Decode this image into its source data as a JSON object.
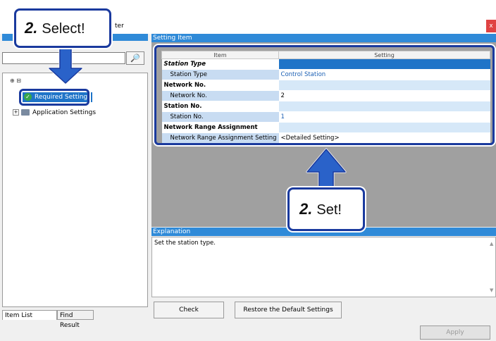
{
  "window": {
    "title_fragment": "ter",
    "close_label": "x"
  },
  "left_panel": {
    "search_value": "",
    "search_button_icon": "binoculars-icon",
    "tree_tools": "⊕ ⊟",
    "tree": [
      {
        "label": "Required Settings",
        "icon": "check-icon",
        "selected": true
      },
      {
        "label": "Application Settings",
        "icon": "folder-icon",
        "expander": "⊞"
      }
    ],
    "tabs": [
      "Item List",
      "Find Result"
    ]
  },
  "setting_item": {
    "header": "Setting Item",
    "columns": [
      "Item",
      "Setting"
    ],
    "rows": [
      {
        "type": "category",
        "item": "Station Type",
        "setting": ""
      },
      {
        "type": "sub",
        "item": "Station Type",
        "setting": "Control Station"
      },
      {
        "type": "category",
        "item": "Network No.",
        "setting": ""
      },
      {
        "type": "sub",
        "item": "Network No.",
        "setting": "2"
      },
      {
        "type": "category",
        "item": "Station No.",
        "setting": ""
      },
      {
        "type": "sub",
        "item": "Station No.",
        "setting": "1"
      },
      {
        "type": "category",
        "item": "Network Range Assignment",
        "setting": ""
      },
      {
        "type": "sub",
        "item": "Network Range Assignment Setting",
        "setting": "<Detailed Setting>"
      }
    ]
  },
  "explanation": {
    "header": "Explanation",
    "text": "Set the station type."
  },
  "buttons": {
    "check": "Check",
    "restore": "Restore the Default Settings",
    "apply": "Apply"
  },
  "callouts": {
    "select": {
      "number": "2.",
      "word": "Select!"
    },
    "set": {
      "number": "2.",
      "word": "Set!"
    }
  },
  "colors": {
    "accent": "#2f8ad8",
    "callout_border": "#1a3a9e",
    "arrow": "#1a3a9e",
    "arrow_fill": "#2a62c9"
  }
}
